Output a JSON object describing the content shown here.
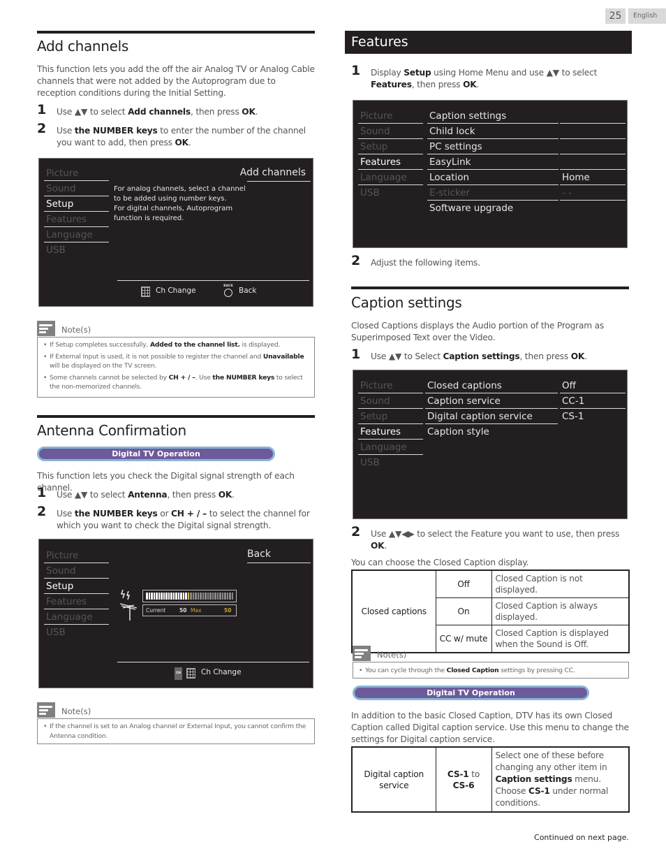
{
  "page": {
    "number": "25",
    "language": "English",
    "continued": "Continued on next page."
  },
  "add_channels": {
    "title": "Add channels",
    "intro": "This function lets you add the off the air Analog TV or Analog Cable channels that were not added by the Autoprogram due to reception conditions during the Initial Setting.",
    "steps": [
      {
        "num": "1",
        "pre": "Use ▲▼ to select ",
        "b1": "Add channels",
        "mid": ", then press ",
        "b2": "OK",
        "post": "."
      },
      {
        "num": "2",
        "pre": "Use ",
        "b1": "the NUMBER keys",
        "mid": " to enter the number of the channel you want to add, then press ",
        "b2": "OK",
        "post": "."
      }
    ],
    "tv": {
      "side": [
        "Picture",
        "Sound",
        "Setup",
        "Features",
        "Language",
        "USB"
      ],
      "active": "Setup",
      "header": "Add channels",
      "message": [
        "For analog channels, select a channel",
        "to be added using number keys.",
        "For digital channels, Autoprogram",
        "function is required."
      ],
      "footer": {
        "ch_change": "Ch Change",
        "back": "Back",
        "back_icon_label": "BACK"
      }
    },
    "notes_label": "Note(s)",
    "notes": [
      {
        "pre": "If Setup completes successfully, ",
        "b": "Added to the channel list.",
        "post": " is displayed."
      },
      {
        "pre": "If External Input is used, it is not possible to register the channel and ",
        "b": "Unavailable",
        "post": " will be displayed on the TV screen."
      },
      {
        "pre": "Some channels cannot be selected by ",
        "b": "CH + / –",
        "mid": ". Use ",
        "b2": "the NUMBER keys",
        "post": " to select the non-memorized channels."
      }
    ]
  },
  "antenna": {
    "title": "Antenna Confirmation",
    "badge": "Digital TV Operation",
    "intro": "This function lets you check the Digital signal strength of each channel.",
    "steps": [
      {
        "num": "1",
        "pre": "Use ▲▼ to select ",
        "b1": "Antenna",
        "mid": ", then press ",
        "b2": "OK",
        "post": "."
      },
      {
        "num": "2",
        "pre": "Use ",
        "b1": "the NUMBER keys",
        "mid": " or ",
        "b2": "CH + / –",
        "post": " to select the channel for which you want to check the Digital signal strength."
      }
    ],
    "tv": {
      "side": [
        "Picture",
        "Sound",
        "Setup",
        "Features",
        "Language",
        "USB"
      ],
      "active": "Setup",
      "header": "Back",
      "signal": {
        "current_label": "Current",
        "current": "50",
        "max_label": "Max",
        "max": "50",
        "level_percent": 50
      },
      "footer": {
        "ch_change": "Ch Change",
        "ch_icon_label": "CH"
      }
    },
    "notes_label": "Note(s)",
    "notes": [
      "If the channel is set to an Analog channel or External Input, you cannot confirm the Antenna condition."
    ]
  },
  "features": {
    "title": "Features",
    "step1": {
      "num": "1",
      "pre": "Display ",
      "b1": "Setup",
      "mid": " using Home Menu and use ▲▼ to select ",
      "b2": "Features",
      "post": ", then press ",
      "b3": "OK",
      "end": "."
    },
    "tv": {
      "side": [
        "Picture",
        "Sound",
        "Setup",
        "Features",
        "Language",
        "USB"
      ],
      "active": "Features",
      "items": [
        {
          "label": "Caption settings",
          "value": ""
        },
        {
          "label": "Child lock",
          "value": ""
        },
        {
          "label": "PC settings",
          "value": ""
        },
        {
          "label": "EasyLink",
          "value": ""
        },
        {
          "label": "Location",
          "value": "Home"
        },
        {
          "label": "E-sticker",
          "value": "- -",
          "disabled": true
        },
        {
          "label": "Software upgrade",
          "value": ""
        }
      ]
    },
    "step2": {
      "num": "2",
      "text": "Adjust the following items."
    }
  },
  "caption": {
    "title": "Caption settings",
    "intro": "Closed Captions displays the Audio portion of the Program as Superimposed Text over the Video.",
    "step1": {
      "num": "1",
      "pre": "Use ▲▼ to Select ",
      "b1": "Caption settings",
      "mid": ", then press ",
      "b2": "OK",
      "post": "."
    },
    "tv": {
      "side": [
        "Picture",
        "Sound",
        "Setup",
        "Features",
        "Language",
        "USB"
      ],
      "active": "Features",
      "items": [
        {
          "label": "Closed captions",
          "value": "Off"
        },
        {
          "label": "Caption service",
          "value": "CC-1"
        },
        {
          "label": "Digital caption service",
          "value": "CS-1"
        },
        {
          "label": "Caption style",
          "value": ""
        }
      ]
    },
    "step2": {
      "num": "2",
      "pre": "Use ▲▼◀▶ to select the Feature you want to use, then press ",
      "b": "OK",
      "post": "."
    },
    "table_intro": "You can choose the Closed Caption display.",
    "cc_table": {
      "item": "Closed captions",
      "rows": [
        {
          "option": "Off",
          "desc": "Closed Caption is not displayed."
        },
        {
          "option": "On",
          "desc": "Closed Caption is always displayed."
        },
        {
          "option": "CC w/ mute",
          "desc": "Closed Caption is displayed when the Sound is Off."
        }
      ]
    },
    "notes_label": "Note(s)",
    "note": {
      "pre": "You can cycle through the ",
      "b": "Closed Caption",
      "post": " settings by pressing CC."
    },
    "badge": "Digital TV Operation",
    "dtv_intro": "In addition to the basic Closed Caption, DTV has its own Closed Caption called Digital caption service. Use this menu to change the settings for Digital caption service.",
    "dcs_table": {
      "item": "Digital caption service",
      "opt_b1": "CS-1",
      "opt_mid": " to ",
      "opt_b2": "CS-6",
      "desc_pre": "Select one of these before changing any other item in ",
      "desc_b1": "Caption settings",
      "desc_mid": " menu. Choose ",
      "desc_b2": "CS-1",
      "desc_post": " under normal conditions."
    }
  }
}
